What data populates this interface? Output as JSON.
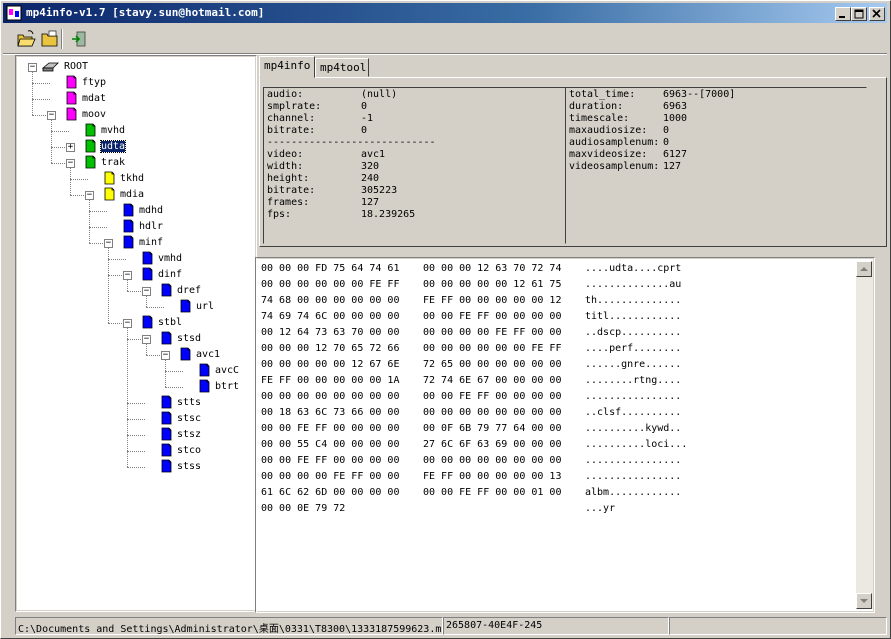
{
  "window": {
    "title": "mp4info-v1.7 [stavy.sun@hotmail.com]"
  },
  "tree": [
    {
      "label": "ROOT",
      "color": "root"
    },
    {
      "label": "ftyp",
      "color": "#ff00ff"
    },
    {
      "label": "mdat",
      "color": "#ff00ff"
    },
    {
      "label": "moov",
      "color": "#ff00ff"
    },
    {
      "label": "mvhd",
      "color": "#00c000"
    },
    {
      "label": "udta",
      "color": "#00c000"
    },
    {
      "label": "trak",
      "color": "#00c000"
    },
    {
      "label": "tkhd",
      "color": "#ffff00"
    },
    {
      "label": "mdia",
      "color": "#ffff00"
    },
    {
      "label": "mdhd",
      "color": "#0000ff"
    },
    {
      "label": "hdlr",
      "color": "#0000ff"
    },
    {
      "label": "minf",
      "color": "#0000ff"
    },
    {
      "label": "vmhd",
      "color": "#0000ff"
    },
    {
      "label": "dinf",
      "color": "#0000ff"
    },
    {
      "label": "dref",
      "color": "#0000ff"
    },
    {
      "label": "url",
      "color": "#0000ff"
    },
    {
      "label": "stbl",
      "color": "#0000ff"
    },
    {
      "label": "stsd",
      "color": "#0000ff"
    },
    {
      "label": "avc1",
      "color": "#0000ff"
    },
    {
      "label": "avcC",
      "color": "#0000ff"
    },
    {
      "label": "btrt",
      "color": "#0000ff"
    },
    {
      "label": "stts",
      "color": "#0000ff"
    },
    {
      "label": "stsc",
      "color": "#0000ff"
    },
    {
      "label": "stsz",
      "color": "#0000ff"
    },
    {
      "label": "stco",
      "color": "#0000ff"
    },
    {
      "label": "stss",
      "color": "#0000ff"
    }
  ],
  "tabs": [
    {
      "label": "mp4info"
    },
    {
      "label": "mp4tool"
    }
  ],
  "info_left": [
    {
      "k": "audio:",
      "v": " (null)"
    },
    {
      "k": "smplrate:",
      "v": "0"
    },
    {
      "k": "channel:",
      "v": "-1"
    },
    {
      "k": "bitrate:",
      "v": "0"
    },
    {
      "k": "----------------------------",
      "v": ""
    },
    {
      "k": "video:",
      "v": "avc1"
    },
    {
      "k": "width:",
      "v": "320"
    },
    {
      "k": "height:",
      "v": "240"
    },
    {
      "k": "bitrate:",
      "v": "305223"
    },
    {
      "k": "frames:",
      "v": "127"
    },
    {
      "k": "fps:",
      "v": "18.239265"
    }
  ],
  "info_right": [
    {
      "k": "total_time:",
      "v": "6963--[7000]"
    },
    {
      "k": "duration:",
      "v": "6963"
    },
    {
      "k": "timescale:",
      "v": "1000"
    },
    {
      "k": "maxaudiosize:",
      "v": "0"
    },
    {
      "k": "audiosamplenum:",
      "v": "0"
    },
    {
      "k": "maxvideosize:",
      "v": "6127"
    },
    {
      "k": "videosamplenum:",
      "v": "127"
    }
  ],
  "hex": [
    {
      "a": "00 00 00 FD 75 64 74 61",
      "b": "00 00 00 12 63 70 72 74",
      "c": "....udta....cprt"
    },
    {
      "a": "00 00 00 00 00 00 FE FF",
      "b": "00 00 00 00 00 12 61 75",
      "c": "..............au"
    },
    {
      "a": "74 68 00 00 00 00 00 00",
      "b": "FE FF 00 00 00 00 00 12",
      "c": "th.............."
    },
    {
      "a": "74 69 74 6C 00 00 00 00",
      "b": "00 00 FE FF 00 00 00 00",
      "c": "titl............"
    },
    {
      "a": "00 12 64 73 63 70 00 00",
      "b": "00 00 00 00 FE FF 00 00",
      "c": "..dscp.........."
    },
    {
      "a": "00 00 00 12 70 65 72 66",
      "b": "00 00 00 00 00 00 FE FF",
      "c": "....perf........"
    },
    {
      "a": "00 00 00 00 00 12 67 6E",
      "b": "72 65 00 00 00 00 00 00",
      "c": "......gnre......"
    },
    {
      "a": "FE FF 00 00 00 00 00 1A",
      "b": "72 74 6E 67 00 00 00 00",
      "c": "........rtng...."
    },
    {
      "a": "00 00 00 00 00 00 00 00",
      "b": "00 00 FE FF 00 00 00 00",
      "c": "................"
    },
    {
      "a": "00 18 63 6C 73 66 00 00",
      "b": "00 00 00 00 00 00 00 00",
      "c": "..clsf.........."
    },
    {
      "a": "00 00 FE FF 00 00 00 00",
      "b": "00 0F 6B 79 77 64 00 00",
      "c": "..........kywd.."
    },
    {
      "a": "00 00 55 C4 00 00 00 00",
      "b": "27 6C 6F 63 69 00 00 00",
      "c": "..........loci..."
    },
    {
      "a": "00 00 FE FF 00 00 00 00",
      "b": "00 00 00 00 00 00 00 00",
      "c": "................"
    },
    {
      "a": "00 00 00 00 FE FF 00 00",
      "b": "FE FF 00 00 00 00 00 13",
      "c": "................"
    },
    {
      "a": "61 6C 62 6D 00 00 00 00",
      "b": "00 00 FE FF 00 00 01 00",
      "c": "albm............"
    },
    {
      "a": "00 00 0E 79 72",
      "b": "",
      "c": "...yr"
    }
  ],
  "status": {
    "path": "C:\\Documents and Settings\\Administrator\\桌面\\0331\\T8300\\1333187599623.m",
    "code": "265807-40E4F-245",
    "extra": ""
  }
}
